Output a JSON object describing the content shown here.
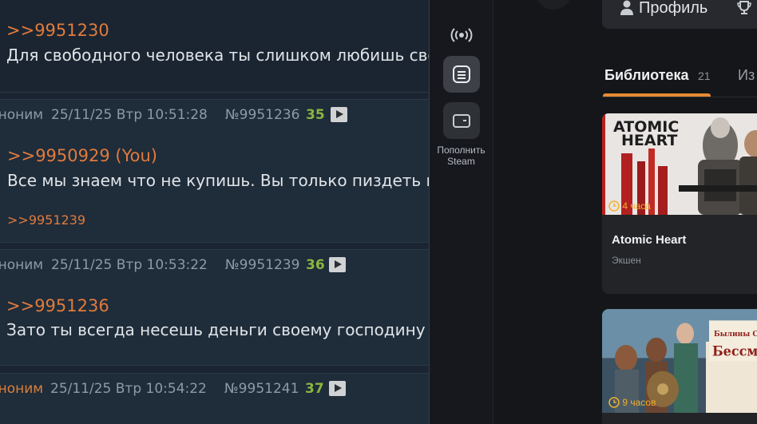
{
  "board": {
    "post1": {
      "reply": ">>9951230",
      "text": "Для свободного человека ты слишком любишь сво"
    },
    "post2": {
      "name": "Аноним",
      "date": "25/11/25 Втр 10:51:28",
      "num": "№9951236",
      "count": "35",
      "reply": ">>9950929 (You)",
      "text": "Все мы знаем что не купишь. Вы только пиздеть го",
      "backlink": ">>9951239"
    },
    "post3": {
      "name": "Аноним",
      "date": "25/11/25 Втр 10:53:22",
      "num": "№9951239",
      "count": "36",
      "reply": ">>9951236",
      "text": "Зато ты всегда несешь деньги своему господину и"
    },
    "post4": {
      "name": "Аноним",
      "date": "25/11/25 Втр 10:54:22",
      "num": "№9951241",
      "count": "37"
    }
  },
  "sidebar": {
    "wallet_label_line1": "Пополнить",
    "wallet_label_line2": "Steam"
  },
  "panel": {
    "profile_label": "Профиль",
    "tab_library": "Библиотека",
    "tab_library_count": "21",
    "tab_other": "Из",
    "games": [
      {
        "title": "Atomic Heart",
        "genre": "Экшен",
        "time": "4 часа",
        "logo_line1": "ATOMIC",
        "logo_line2": "HEART"
      },
      {
        "time": "9 часов",
        "logo_line1": "Былины Святой",
        "logo_line2": "Бессмерт"
      }
    ]
  },
  "colors": {
    "accent": "#e88a35",
    "link": "#e07b3c",
    "counter": "#8ab63f",
    "playtime": "#f2b02f"
  }
}
